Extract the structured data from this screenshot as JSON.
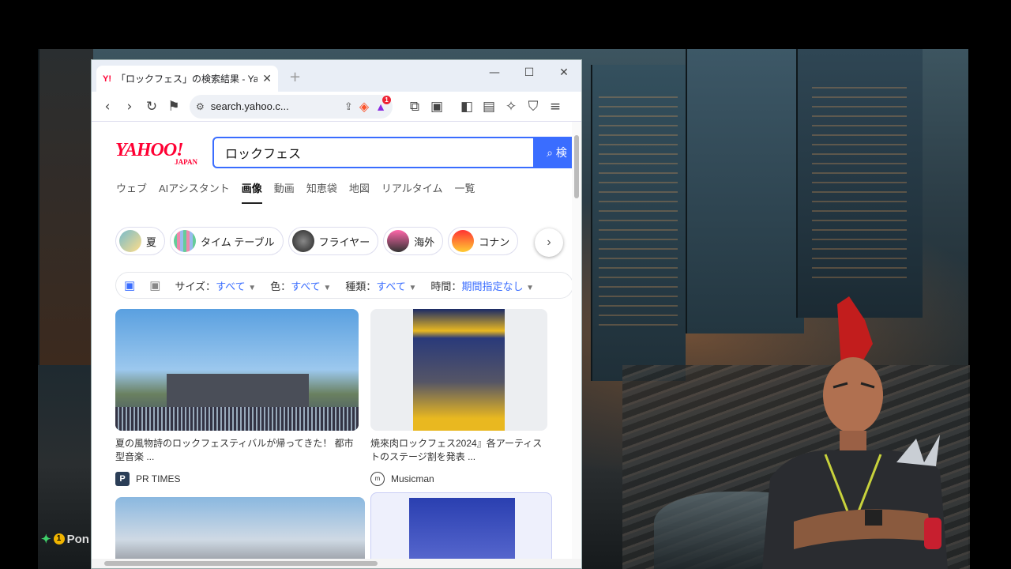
{
  "browser": {
    "tab_title": "「ロックフェス」の検索結果 - Yahoo!検",
    "tab_favicon": "Y!",
    "url": "search.yahoo.c...",
    "rewards_badge": "1"
  },
  "yahoo": {
    "logo_main": "YAHOO!",
    "logo_sub": "JAPAN",
    "query": "ロックフェス",
    "search_button": "検"
  },
  "nav": [
    "ウェブ",
    "AIアシスタント",
    "画像",
    "動画",
    "知恵袋",
    "地図",
    "リアルタイム",
    "一覧"
  ],
  "nav_active": "画像",
  "chips": [
    "夏",
    "タイム テーブル",
    "フライヤー",
    "海外",
    "コナン"
  ],
  "filters": {
    "size_label": "サイズ：",
    "size_value": "すべて",
    "color_label": "色：",
    "color_value": "すべて",
    "kind_label": "種類：",
    "kind_value": "すべて",
    "time_label": "時間：",
    "time_value": "期間指定なし"
  },
  "results": [
    {
      "caption": "夏の風物詩のロックフェスティバルが帰ってきた！ 都市型音楽 ...",
      "source": "PR TIMES",
      "source_icon": "P"
    },
    {
      "caption": "焼來肉ロックフェス2024』各アーティストのステージ割を発表 ...",
      "source": "Musicman",
      "source_icon": "m"
    }
  ],
  "stream_badge": {
    "prefix": "✦",
    "count": "1",
    "text": "Pon"
  },
  "colors": {
    "yahoo_red": "#ff0033",
    "accent_blue": "#3a6dff"
  }
}
